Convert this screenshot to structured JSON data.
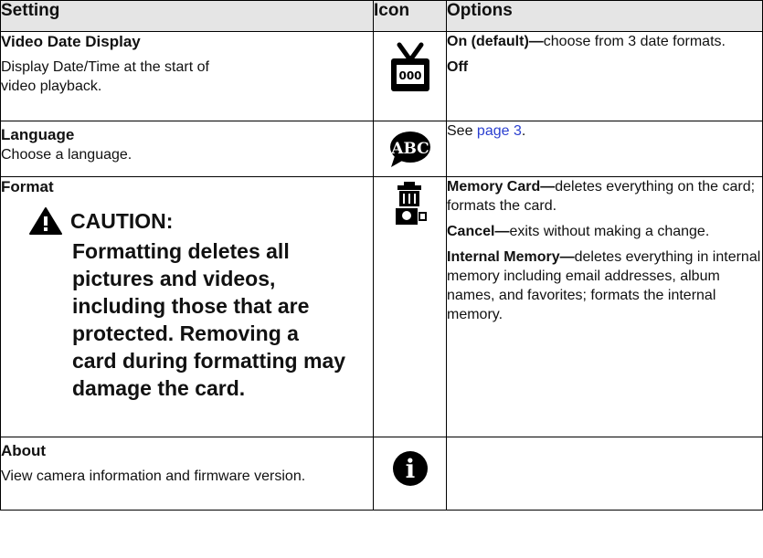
{
  "headers": {
    "setting": "Setting",
    "icon": "Icon",
    "options": "Options"
  },
  "rows": [
    {
      "title": "Video Date Display",
      "desc": "Display Date/Time at the start of video playback.",
      "icon": "tv-date-icon",
      "options": [
        {
          "bold": "On (default)—",
          "text": "choose from 3 date formats."
        },
        {
          "bold": "Off",
          "text": ""
        }
      ]
    },
    {
      "title": "Language",
      "desc": "Choose a language.",
      "icon": "abc-speech-bubble-icon",
      "icon_text": "ABC",
      "options_prefix": "See ",
      "options_link": "page 3",
      "options_suffix": "."
    },
    {
      "title": "Format",
      "icon": "trash-memory-card-icon",
      "caution_label": "CAUTION:",
      "caution_text": "Formatting deletes all pictures and videos, including those that are protected. Removing a card during formatting may damage the card.",
      "options": [
        {
          "bold": "Memory Card—",
          "text": "deletes everything on the card; formats the card."
        },
        {
          "bold": "Cancel—",
          "text": "exits without making a change."
        },
        {
          "bold": "Internal Memory—",
          "text": "deletes everything in internal memory including email addresses, album names, and favorites; formats the internal memory."
        }
      ]
    },
    {
      "title": "About",
      "desc": "View camera information and firmware version.",
      "icon": "info-icon",
      "icon_text": "i"
    }
  ]
}
